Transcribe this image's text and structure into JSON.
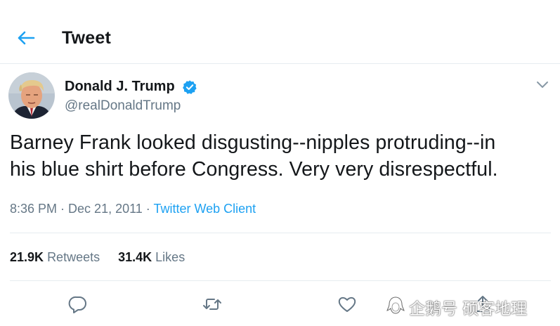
{
  "header": {
    "title": "Tweet",
    "back_icon": "arrow-left-icon"
  },
  "author": {
    "name": "Donald J. Trump",
    "handle": "@realDonaldTrump",
    "verified": true
  },
  "tweet": {
    "line1": "Barney Frank looked disgusting--nipples protruding--in",
    "line2": "his blue shirt before Congress. Very very disrespectful."
  },
  "meta": {
    "time": "8:36 PM",
    "date": "Dec 21, 2011",
    "source": "Twitter Web Client"
  },
  "stats": {
    "retweets_count": "21.9K",
    "retweets_label": "Retweets",
    "likes_count": "31.4K",
    "likes_label": "Likes"
  },
  "actions": [
    "reply-icon",
    "retweet-icon",
    "like-icon",
    "share-icon"
  ],
  "watermark": {
    "text": "企鹅号 硕客地理"
  },
  "colors": {
    "accent": "#1da1f2",
    "muted": "#657786",
    "divider": "#e6ecf0",
    "text": "#14171a"
  }
}
